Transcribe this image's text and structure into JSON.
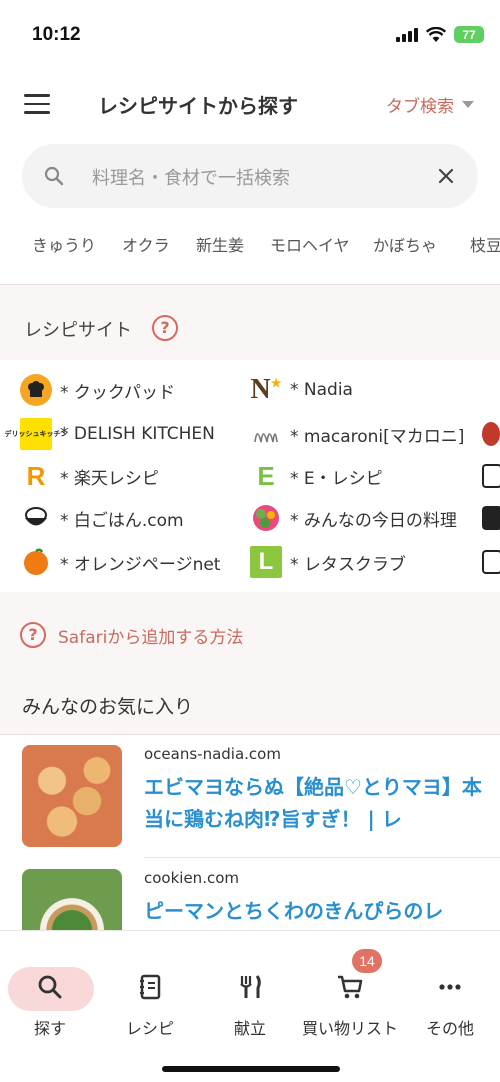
{
  "status_bar": {
    "time": "10:12",
    "battery": "77"
  },
  "header": {
    "title": "レシピサイトから探す",
    "tab_search": "タブ検索"
  },
  "search": {
    "placeholder": "料理名・食材で一括検索"
  },
  "keywords": [
    "きゅうり",
    "オクラ",
    "新生姜",
    "モロヘイヤ",
    "かぼちゃ",
    "枝豆"
  ],
  "recipe_sites": {
    "title": "レシピサイト",
    "help": "?",
    "items": [
      {
        "label": "* クックパッド",
        "icon": "cookpad-logo"
      },
      {
        "label": "* Nadia",
        "icon": "nadia-logo"
      },
      {
        "label": "* DELISH KITCHEN",
        "icon": "delish-kitchen-logo",
        "icon_text": "デリッシュキッチン"
      },
      {
        "label": "* macaroni[マカロニ]",
        "icon": "macaroni-logo"
      },
      {
        "label": "* 楽天レシピ",
        "icon": "rakuten-logo",
        "icon_text": "R"
      },
      {
        "label": "* E・レシピ",
        "icon": "e-recipe-logo",
        "icon_text": "E"
      },
      {
        "label": "* 白ごはん.com",
        "icon": "rice-bowl-logo"
      },
      {
        "label": "* みんなの今日の料理",
        "icon": "minna-logo"
      },
      {
        "label": "* オレンジページnet",
        "icon": "orange-logo"
      },
      {
        "label": "* レタスクラブ",
        "icon": "lettuce-club-logo",
        "icon_text": "L"
      }
    ]
  },
  "safari_link": {
    "label": "Safariから追加する方法",
    "icon": "?"
  },
  "favorites": {
    "title": "みんなのお気に入り",
    "items": [
      {
        "domain": "oceans-nadia.com",
        "title": "エビマヨならぬ【絶品♡とりマヨ】本当に鶏むね肉⁉旨すぎ！ | レ"
      },
      {
        "domain": "cookien.com",
        "title": "ピーマンとちくわのきんぴらのレ"
      }
    ]
  },
  "tab_bar": {
    "tabs": [
      {
        "label": "探す",
        "icon": "search-icon",
        "active": true
      },
      {
        "label": "レシピ",
        "icon": "recipe-book-icon"
      },
      {
        "label": "献立",
        "icon": "fork-knife-icon"
      },
      {
        "label": "買い物リスト",
        "icon": "cart-icon",
        "badge": "14"
      },
      {
        "label": "その他",
        "icon": "more-icon"
      }
    ]
  },
  "colors": {
    "accent": "#c96a5e",
    "link": "#2a8fcf",
    "active_pill": "#f8d8d8"
  }
}
